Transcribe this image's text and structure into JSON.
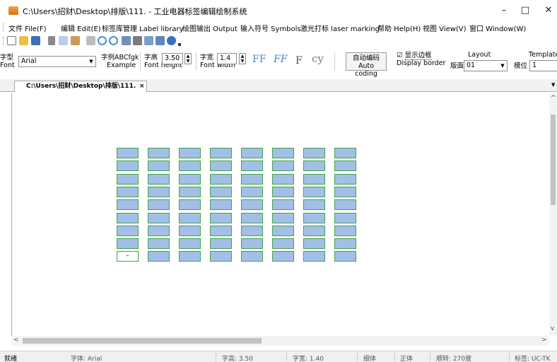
{
  "window": {
    "title": "C:\\Users\\招财\\Desktop\\排版\\111. - 工业电器标签编辑绘制系统",
    "minimize": "–",
    "maximize": "□",
    "close": "✕"
  },
  "menu": [
    "文件 File(F)",
    "编辑 Edit(E)",
    "标签库管理 Label library",
    "绘图输出 Output",
    "输入符号 Symbols",
    "激光打标 laser marking",
    "帮助 Help(H)",
    "视图 View(V)",
    "窗口 Window(W)"
  ],
  "format": {
    "font_label_cn": "字型",
    "font_label_en": "Font",
    "font_value": "Arial",
    "example_cn": "字例ABCfgk",
    "example_en": "Example",
    "height_cn": "字高",
    "height_en": "Font height",
    "height_value": "3.50",
    "width_cn": "字宽",
    "width_en": "Font width",
    "width_value": "1.4",
    "cy_text": "cy",
    "auto_coding_cn": "自动编码",
    "auto_coding_en": "Auto coding",
    "display_border_cn": "显示边框",
    "display_border_en": "Display border",
    "display_border_checked": "☑",
    "layout_title": "Layout",
    "layout_label": "版面",
    "layout_value": "01",
    "template_title": "Template",
    "template_label": "模位",
    "template_value": "1"
  },
  "tab": {
    "title": "C:\\Users\\招财\\Desktop\\排版\\111.",
    "close": "×"
  },
  "canvas": {
    "columns": 8,
    "rows": 9,
    "empty_cell_text": "–",
    "cell_fill": "#a3bfe8",
    "cell_border": "#3fa547"
  },
  "scroll": {
    "left": "<",
    "right": ">",
    "up": "^",
    "down": "v"
  },
  "status": {
    "ready": "就绪",
    "font": "字体: Arial",
    "height": "字高: 3.50",
    "width": "字宽: 1.40",
    "weight": "细体",
    "style": "正体",
    "rotation": "顺转: 270度",
    "tag": "标签: UC-TK"
  }
}
